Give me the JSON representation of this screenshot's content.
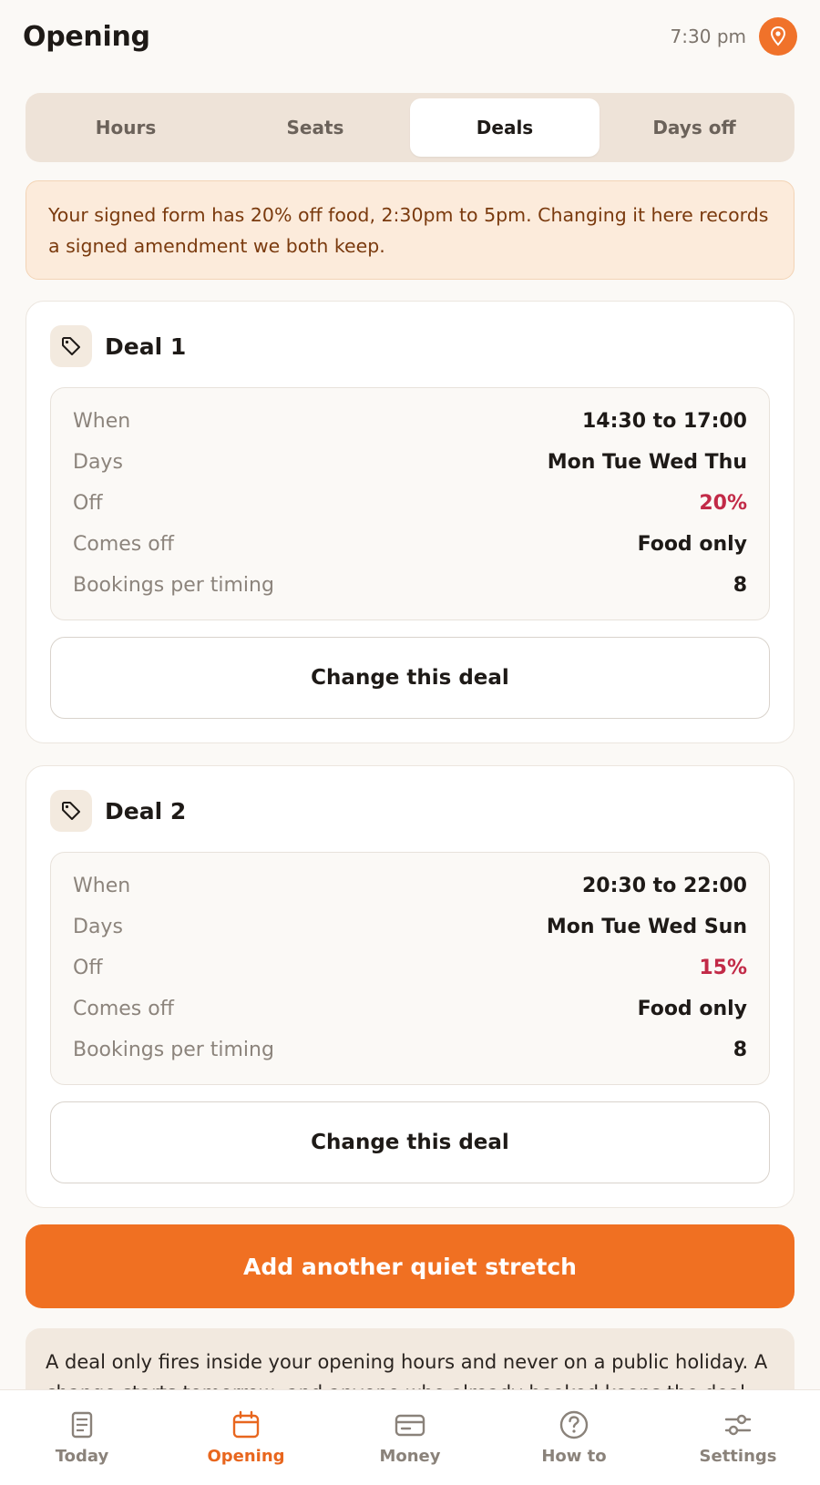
{
  "header": {
    "title": "Opening",
    "time": "7:30 pm"
  },
  "tabs": [
    {
      "label": "Hours",
      "active": false
    },
    {
      "label": "Seats",
      "active": false
    },
    {
      "label": "Deals",
      "active": true
    },
    {
      "label": "Days off",
      "active": false
    }
  ],
  "notice": "Your signed form has 20% off food, 2:30pm to 5pm. Changing it here records a signed amendment we both keep.",
  "deals": [
    {
      "title": "Deal 1",
      "rows": [
        {
          "label": "When",
          "value": "14:30 to 17:00"
        },
        {
          "label": "Days",
          "value": "Mon Tue Wed Thu"
        },
        {
          "label": "Off",
          "value": "20%"
        },
        {
          "label": "Comes off",
          "value": "Food only"
        },
        {
          "label": "Bookings per timing",
          "value": "8"
        }
      ],
      "button": "Change this deal"
    },
    {
      "title": "Deal 2",
      "rows": [
        {
          "label": "When",
          "value": "20:30 to 22:00"
        },
        {
          "label": "Days",
          "value": "Mon Tue Wed Sun"
        },
        {
          "label": "Off",
          "value": "15%"
        },
        {
          "label": "Comes off",
          "value": "Food only"
        },
        {
          "label": "Bookings per timing",
          "value": "8"
        }
      ],
      "button": "Change this deal"
    }
  ],
  "add_button": "Add another quiet stretch",
  "footnote": "A deal only fires inside your opening hours and never on a public holiday. A change starts tomorrow, and anyone who already booked keeps the deal.",
  "nav": [
    {
      "label": "Today",
      "icon": "today-icon",
      "active": false
    },
    {
      "label": "Opening",
      "icon": "calendar-icon",
      "active": true
    },
    {
      "label": "Money",
      "icon": "card-icon",
      "active": false
    },
    {
      "label": "How to",
      "icon": "help-icon",
      "active": false
    },
    {
      "label": "Settings",
      "icon": "sliders-icon",
      "active": false
    }
  ],
  "colors": {
    "accent": "#F07022",
    "percent": "#C22A47",
    "notice_bg": "#FCEBDB",
    "notice_text": "#7A3A0E"
  }
}
